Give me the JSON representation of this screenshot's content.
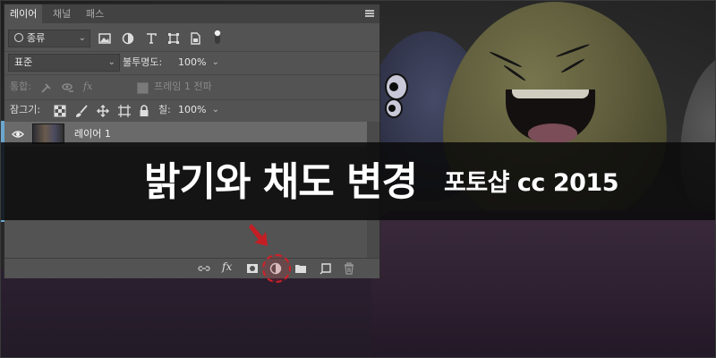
{
  "colors": {
    "panel_bg": "#535353",
    "tab_bar_bg": "#424242",
    "selected_layer_bg": "#6a6a6a",
    "banner_bg": "#0f0f0f",
    "highlight_red": "#d31f28",
    "accent_blue": "#6aa6cf"
  },
  "panel": {
    "tabs": [
      {
        "label": "레이어",
        "active": true
      },
      {
        "label": "채널",
        "active": false
      },
      {
        "label": "패스",
        "active": false
      }
    ],
    "filter": {
      "kind_label": "종류",
      "icons": [
        "image-filter-icon",
        "adjustment-filter-icon",
        "type-filter-icon",
        "shape-filter-icon",
        "smart-object-filter-icon",
        "filter-toggle-icon"
      ]
    },
    "blend": {
      "mode": "표준",
      "opacity_label": "불투명도:",
      "opacity_value": "100%"
    },
    "unify": {
      "label": "통합:",
      "propagate_label": "프레임 1 전파"
    },
    "lock": {
      "label": "잠그기:",
      "fill_label": "칠:",
      "fill_value": "100%"
    },
    "layers": [
      {
        "name": "레이어 1",
        "visible": true,
        "selected": true
      }
    ],
    "bottom_icons": [
      "link-layers-icon",
      "fx-icon",
      "layer-mask-icon",
      "adjustment-layer-icon",
      "group-folder-icon",
      "new-layer-icon",
      "trash-icon"
    ]
  },
  "banner": {
    "title": "밝기와 채도 변경",
    "subtitle": "포토샵 cc 2015"
  }
}
